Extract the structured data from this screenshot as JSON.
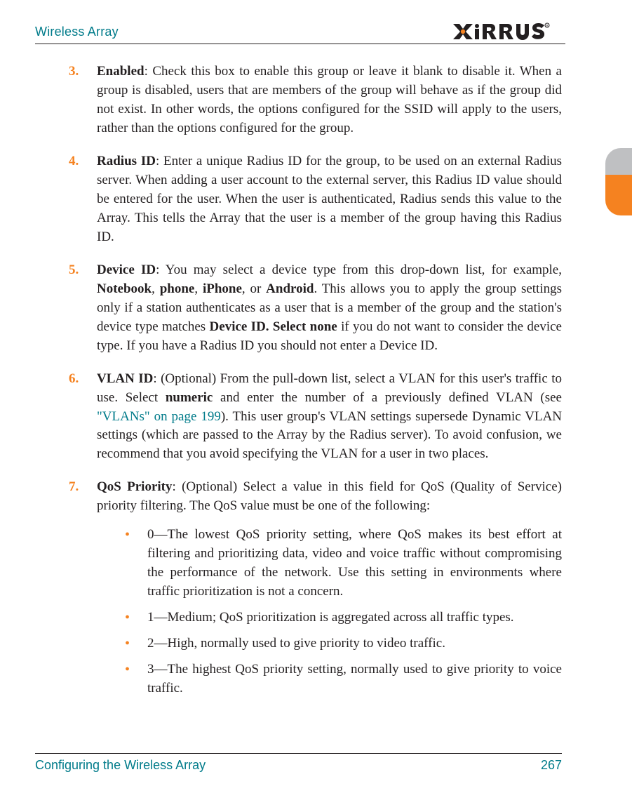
{
  "header": {
    "title": "Wireless Array",
    "logo_text": "XIRRUS"
  },
  "footer": {
    "section": "Configuring the Wireless Array",
    "page_number": "267"
  },
  "steps": [
    {
      "num": "3.",
      "label": "Enabled",
      "body": ": Check this box to enable this group or leave it blank to disable it. When a group is disabled, users that are members of the group will behave as if the group did not exist. In other words, the options configured for the SSID will apply to the users, rather than the options configured for the group."
    },
    {
      "num": "4.",
      "label": "Radius ID",
      "body": ": Enter a unique Radius ID for the group, to be used on an external Radius server. When adding a user account to the external server, this Radius ID value should be entered for the user. When the user is authenticated, Radius sends this value to the Array. This tells the Array that the user is a member of the group having this Radius ID."
    },
    {
      "num": "5.",
      "label": "Device ID",
      "body_a": ": You may select a device type from this drop-down list, for example, ",
      "bold_list": "Notebook",
      "body_b": ", ",
      "bold_list2": "phone",
      "body_c": ", ",
      "bold_list3": "iPhone",
      "body_d": ", or ",
      "bold_list4": "Android",
      "body_e": ". This allows you to apply the group settings only if a station authenticates as a user that is a member of the group and the station's device type matches ",
      "bold_tail": "Device ID. Select none",
      "body_f": " if you do not want to consider the device type. If you have a Radius ID you should not enter a Device ID."
    },
    {
      "num": "6.",
      "label": "VLAN ID",
      "body_a": ": (Optional) From the pull-down list, select a VLAN for this user's traffic to use. Select ",
      "bold_mid": "numeric",
      "body_b": " and enter the number of a previously defined VLAN (see ",
      "link_text": "\"VLANs\" on page 199",
      "body_c": "). This user group's VLAN settings supersede Dynamic VLAN settings (which are passed to the Array by the Radius server). To avoid confusion, we recommend that you avoid specifying the VLAN for a user in two places."
    },
    {
      "num": "7.",
      "label": "QoS Priority",
      "body": ": (Optional) Select a value in this field for QoS (Quality of Service) priority filtering. The QoS value must be one of the following:",
      "bullets": [
        "0—The lowest QoS priority setting, where QoS makes its best effort at filtering and prioritizing data, video and voice traffic without compromising the performance of the network. Use this setting in environments where traffic prioritization is not a concern.",
        "1—Medium; QoS prioritization is aggregated across all traffic types.",
        "2—High, normally used to give priority to video traffic.",
        "3—The highest QoS priority setting, normally used to give priority to voice traffic."
      ]
    }
  ]
}
